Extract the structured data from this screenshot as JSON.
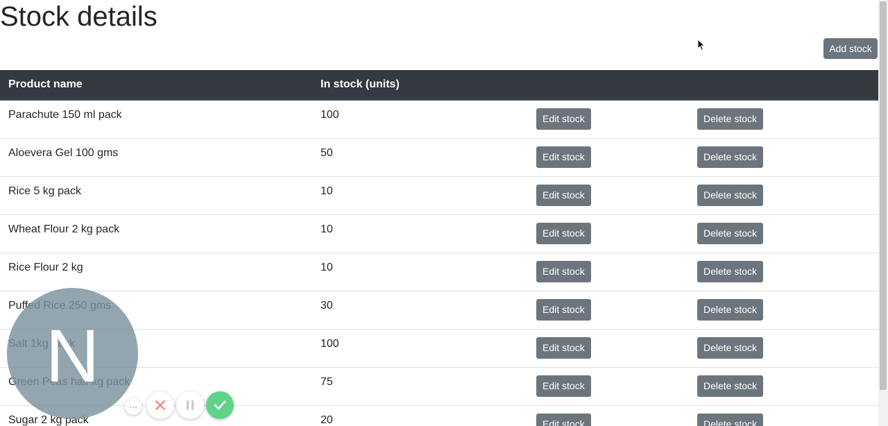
{
  "page": {
    "title": "Stock details",
    "add_button": "Add stock"
  },
  "table": {
    "headers": [
      "Product name",
      "In stock (units)",
      "",
      ""
    ],
    "edit_label": "Edit stock",
    "delete_label": "Delete stock",
    "rows": [
      {
        "name": "Parachute 150 ml pack",
        "stock": "100"
      },
      {
        "name": "Aloevera Gel 100 gms",
        "stock": "50"
      },
      {
        "name": "Rice 5 kg pack",
        "stock": "10"
      },
      {
        "name": "Wheat Flour 2 kg pack",
        "stock": "10"
      },
      {
        "name": "Rice Flour 2 kg",
        "stock": "10"
      },
      {
        "name": "Puffed Rice 250 gms",
        "stock": "30"
      },
      {
        "name": "Salt 1kg pack",
        "stock": "100"
      },
      {
        "name": "Green Peas half kg pack",
        "stock": "75"
      },
      {
        "name": "Sugar 2 kg pack",
        "stock": "20"
      }
    ]
  },
  "overlay": {
    "letter": "N",
    "more_glyph": "···"
  },
  "colors": {
    "header_bg": "#343a40",
    "button_bg": "#6c757d",
    "overlay_bg": "#7b919c",
    "confirm_green": "#5fd38a",
    "cancel_red": "#f07a7a"
  },
  "icons": [
    "more-icon",
    "close-icon",
    "pause-icon",
    "check-icon",
    "cursor-icon"
  ]
}
